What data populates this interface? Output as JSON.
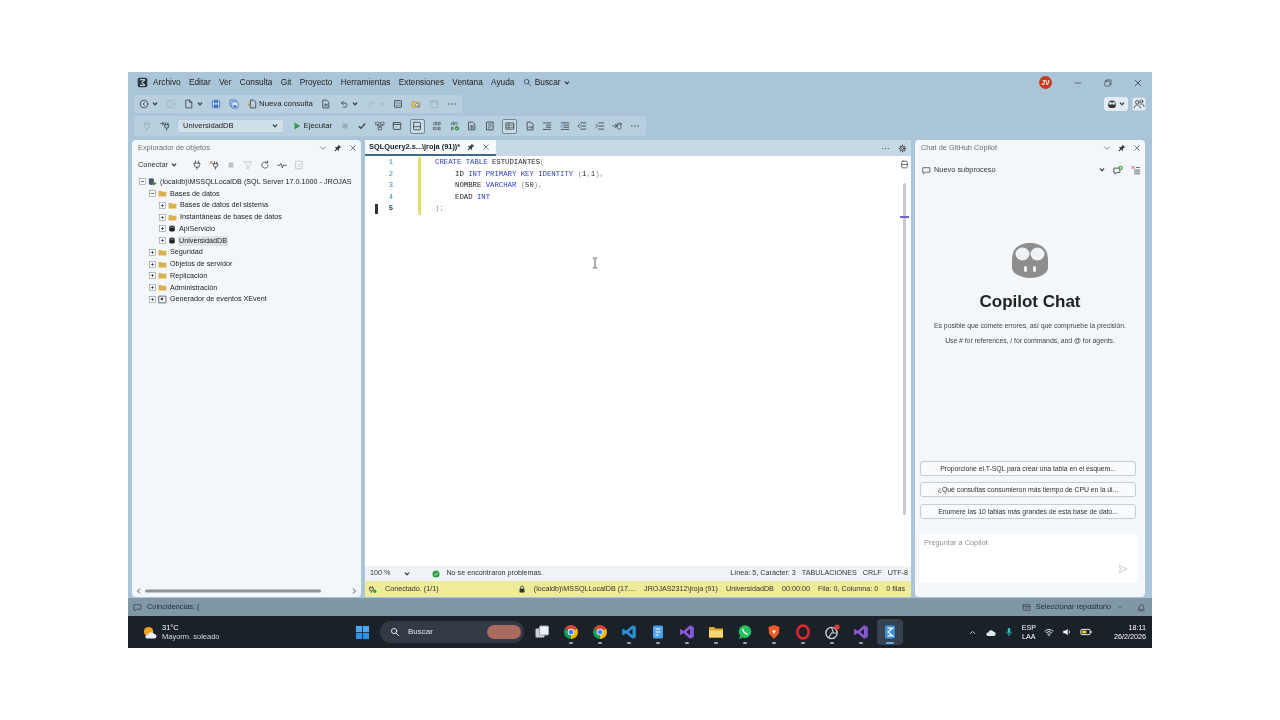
{
  "menu_bar": {
    "items": [
      "Archivo",
      "Editar",
      "Ver",
      "Consulta",
      "Git",
      "Proyecto",
      "Herramientas",
      "Extensiones",
      "Ventana",
      "Ayuda"
    ],
    "search": "Buscar",
    "avatar": "JV"
  },
  "toolbar_standard": [
    {
      "kind": "back",
      "dropdown": true,
      "disabled": false
    },
    {
      "kind": "forward",
      "dropdown": false,
      "disabled": true
    },
    {
      "kind": "new-file",
      "dropdown": true,
      "disabled": false
    },
    {
      "kind": "save",
      "dropdown": false,
      "disabled": false
    },
    {
      "kind": "save-all",
      "dropdown": false,
      "disabled": false
    },
    {
      "kind": "new-query",
      "label": "Nueva consulta",
      "disabled": false
    },
    {
      "kind": "query-file",
      "dropdown": false,
      "disabled": false
    },
    {
      "kind": "undo",
      "dropdown": true,
      "disabled": false
    },
    {
      "kind": "redo",
      "dropdown": true,
      "disabled": true
    },
    {
      "kind": "report",
      "dropdown": false,
      "disabled": false
    },
    {
      "kind": "find-file",
      "dropdown": false,
      "disabled": false
    },
    {
      "kind": "window",
      "dropdown": false,
      "disabled": true
    },
    {
      "kind": "more",
      "dropdown": false,
      "disabled": false
    }
  ],
  "toolbar_sql": [
    {
      "kind": "plug",
      "disabled": true,
      "on": false
    },
    {
      "kind": "plug-change",
      "disabled": false,
      "on": false
    },
    {
      "kind": "database",
      "value": "UniversidadDB",
      "disabled": false,
      "on": false
    },
    {
      "kind": "execute",
      "label": "Ejecutar",
      "disabled": false,
      "on": false
    },
    {
      "kind": "stop",
      "disabled": true,
      "on": false
    },
    {
      "kind": "check",
      "disabled": false,
      "on": false
    },
    {
      "kind": "plan",
      "disabled": false,
      "on": false
    },
    {
      "kind": "window",
      "disabled": false,
      "on": false
    },
    {
      "kind": "results",
      "disabled": false,
      "on": true
    },
    {
      "kind": "binary",
      "disabled": false,
      "on": false
    },
    {
      "kind": "binary-ok",
      "disabled": false,
      "on": false
    },
    {
      "kind": "grid",
      "disabled": false,
      "on": false
    },
    {
      "kind": "doc",
      "disabled": false,
      "on": false
    },
    {
      "kind": "table",
      "disabled": false,
      "on": true
    },
    {
      "kind": "file",
      "disabled": false,
      "on": false
    },
    {
      "kind": "lines",
      "disabled": false,
      "on": false
    },
    {
      "kind": "lines-alt",
      "disabled": false,
      "on": false
    },
    {
      "kind": "outdent",
      "disabled": false,
      "on": false
    },
    {
      "kind": "indent",
      "disabled": false,
      "on": false
    },
    {
      "kind": "arrow-db",
      "disabled": false,
      "on": false
    },
    {
      "kind": "more",
      "disabled": false,
      "on": false
    }
  ],
  "object_explorer": {
    "title": "Explorador de objetos",
    "toolbar": [
      {
        "kind": "connect",
        "label": "Conectar",
        "disabled": false
      },
      {
        "kind": "plug",
        "disabled": false
      },
      {
        "kind": "unplug",
        "disabled": false
      },
      {
        "kind": "stop",
        "disabled": true
      },
      {
        "kind": "filter",
        "disabled": true
      },
      {
        "kind": "refresh",
        "disabled": false
      },
      {
        "kind": "activity",
        "disabled": false
      },
      {
        "kind": "script",
        "disabled": true
      }
    ],
    "tree": [
      {
        "kind": "server",
        "label": "(localdb)\\MSSQLLocalDB (SQL Server 17.0.1000 - JROJAS",
        "expanded": true,
        "selected": false,
        "children": [
          {
            "kind": "folder",
            "label": "Bases de datos",
            "expanded": true,
            "selected": false,
            "children": [
              {
                "kind": "folder",
                "label": "Bases de datos del sistema",
                "expanded": false,
                "selected": false
              },
              {
                "kind": "folder",
                "label": "Instantáneas de bases de datos",
                "expanded": false,
                "selected": false
              },
              {
                "kind": "database",
                "label": "ApiServicio",
                "expanded": false,
                "selected": false
              },
              {
                "kind": "database",
                "label": "UniversidadDB",
                "expanded": false,
                "selected": true
              }
            ]
          },
          {
            "kind": "folder",
            "label": "Seguridad",
            "expanded": false,
            "selected": false
          },
          {
            "kind": "folder",
            "label": "Objetos de servidor",
            "expanded": false,
            "selected": false
          },
          {
            "kind": "folder",
            "label": "Replicación",
            "expanded": false,
            "selected": false
          },
          {
            "kind": "folder",
            "label": "Administración",
            "expanded": false,
            "selected": false
          },
          {
            "kind": "xevent",
            "label": "Generador de eventos XEvent",
            "expanded": false,
            "selected": false
          }
        ]
      }
    ]
  },
  "editor": {
    "tabs": [
      {
        "title": "SQLQuery2.s...\\jroja (91))*",
        "selected": true
      }
    ],
    "lines": [
      {
        "number": "1",
        "indented": false,
        "modified": true,
        "current": false,
        "tokens": [
          {
            "kind": "keyword",
            "text": "CREATE TABLE"
          },
          {
            "kind": "plain",
            "text": " ESTUDIANTES"
          },
          {
            "kind": "punct",
            "text": "("
          }
        ]
      },
      {
        "number": "2",
        "indented": true,
        "modified": true,
        "current": false,
        "tokens": [
          {
            "kind": "plain",
            "text": "ID"
          },
          {
            "kind": "keyword",
            "text": " INT PRIMARY KEY IDENTITY"
          },
          {
            "kind": "punct",
            "text": " ("
          },
          {
            "kind": "number",
            "text": "1"
          },
          {
            "kind": "punct",
            "text": ","
          },
          {
            "kind": "number",
            "text": "1"
          },
          {
            "kind": "punct",
            "text": "),"
          }
        ]
      },
      {
        "number": "3",
        "indented": true,
        "modified": true,
        "current": false,
        "tokens": [
          {
            "kind": "plain",
            "text": "NOMBRE"
          },
          {
            "kind": "keyword",
            "text": " VARCHAR"
          },
          {
            "kind": "punct",
            "text": " ("
          },
          {
            "kind": "number",
            "text": "50"
          },
          {
            "kind": "punct",
            "text": "),"
          }
        ]
      },
      {
        "number": "4",
        "indented": true,
        "modified": true,
        "current": false,
        "tokens": [
          {
            "kind": "plain",
            "text": "EDAD"
          },
          {
            "kind": "keyword",
            "text": " INT"
          }
        ]
      },
      {
        "number": "5",
        "indented": false,
        "modified": true,
        "current": true,
        "tokens": [
          {
            "kind": "punct",
            "text": ");"
          }
        ]
      }
    ],
    "zoom": "100 %",
    "problems": "No se encontraron problemas.",
    "position": "Línea: 5, Carácter: 3",
    "indentation": "TABULACIONES",
    "line_endings": "CRLF",
    "encoding": "UTF-8"
  },
  "query_status": {
    "connection": "Conectado. (1/1)",
    "server": "(localdb)\\MSSQLLocalDB (17....",
    "user": "JROJAS2312\\jroja (91)",
    "database": "UniversidadDB",
    "elapsed": "00:00:00",
    "position": "Fila: 0, Columna: 0",
    "rows": "0 filas"
  },
  "copilot": {
    "title": "Chat de GitHub Copilot",
    "thread": "Nuevo subproceso",
    "heading": "Copilot Chat",
    "notes": [
      "Es posible que comete errores, así que compruebe la precisión.",
      "Use # for references, / for commands, and @ for agents."
    ],
    "suggestions": [
      "Proporcione el T-SQL para crear una tabla en el esquem...",
      "¿Qué consultas consumieron más tiempo de CPU en la úl...",
      "Enumere las 10 tablas más grandes de esta base de dato..."
    ],
    "input": {
      "placeholder": "Preguntar a Copilot"
    }
  },
  "status_bar": {
    "left": "Coincidencias: (",
    "right": "Seleccionar repositorio"
  },
  "taskbar": {
    "weather": {
      "temperature": "31°C",
      "condition": "Mayorm. soleado"
    },
    "search": "Buscar",
    "apps": [
      {
        "kind": "task-view",
        "running": false,
        "active": false
      },
      {
        "kind": "browser",
        "running": true,
        "active": false
      },
      {
        "kind": "browser",
        "running": true,
        "active": false
      },
      {
        "kind": "code",
        "running": true,
        "active": false
      },
      {
        "kind": "notepad",
        "running": true,
        "active": false
      },
      {
        "kind": "studio",
        "running": true,
        "active": false
      },
      {
        "kind": "files",
        "running": true,
        "active": false
      },
      {
        "kind": "messenger",
        "running": true,
        "active": false
      },
      {
        "kind": "shield-browser",
        "running": true,
        "active": false
      },
      {
        "kind": "ring-browser",
        "running": true,
        "active": false
      },
      {
        "kind": "aperture",
        "running": true,
        "active": false
      },
      {
        "kind": "studio",
        "running": true,
        "active": false
      },
      {
        "kind": "db-studio",
        "running": true,
        "active": true
      }
    ],
    "language": [
      "ESP",
      "LAA"
    ],
    "time": "18:11",
    "date": "26/2/2026"
  }
}
